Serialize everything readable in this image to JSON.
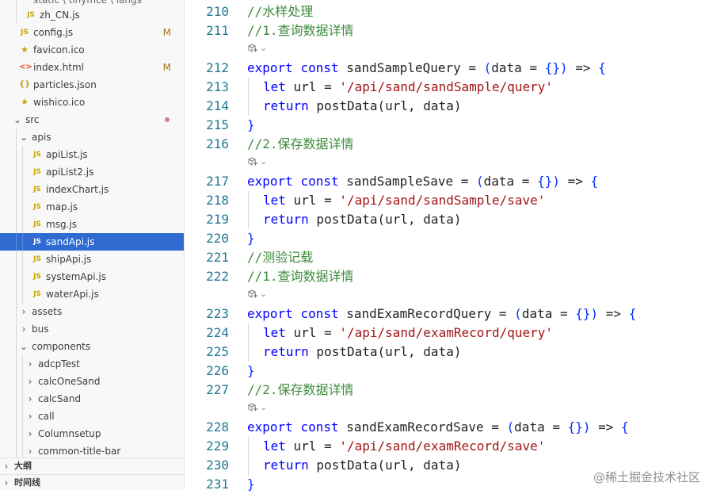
{
  "explorer": {
    "top_partial": "static \\ tinymce \\ langs",
    "items": [
      {
        "name": "zh_CN.js",
        "icon": "js"
      },
      {
        "name": "config.js",
        "icon": "js",
        "badge": "M"
      },
      {
        "name": "favicon.ico",
        "icon": "star"
      },
      {
        "name": "index.html",
        "icon": "html",
        "badge": "M"
      },
      {
        "name": "particles.json",
        "icon": "json"
      },
      {
        "name": "wishico.ico",
        "icon": "star"
      },
      {
        "name": "src",
        "icon": "folder-open"
      },
      {
        "name": "apis",
        "icon": "folder-open"
      },
      {
        "name": "apiList.js",
        "icon": "js"
      },
      {
        "name": "apiList2.js",
        "icon": "js"
      },
      {
        "name": "indexChart.js",
        "icon": "js"
      },
      {
        "name": "map.js",
        "icon": "js"
      },
      {
        "name": "msg.js",
        "icon": "js"
      },
      {
        "name": "sandApi.js",
        "icon": "js",
        "selected": true
      },
      {
        "name": "shipApi.js",
        "icon": "js"
      },
      {
        "name": "systemApi.js",
        "icon": "js"
      },
      {
        "name": "waterApi.js",
        "icon": "js"
      },
      {
        "name": "assets",
        "icon": "folder"
      },
      {
        "name": "bus",
        "icon": "folder"
      },
      {
        "name": "components",
        "icon": "folder-open"
      },
      {
        "name": "adcpTest",
        "icon": "folder"
      },
      {
        "name": "calcOneSand",
        "icon": "folder"
      },
      {
        "name": "calcSand",
        "icon": "folder"
      },
      {
        "name": "call",
        "icon": "folder"
      },
      {
        "name": "Columnsetup",
        "icon": "folder"
      },
      {
        "name": "common-title-bar",
        "icon": "folder"
      }
    ],
    "js_icon_text": "JS",
    "html_icon_text": "<>",
    "json_icon_text": "{}",
    "star_icon_text": "★",
    "badge_text": "M",
    "panels": [
      {
        "label": "大纲"
      },
      {
        "label": "时间线"
      }
    ],
    "colors": {
      "selected_bg": "#2f6bd1",
      "modified": "#a8741a",
      "js": "#c9a400"
    }
  },
  "editor": {
    "lines": [
      {
        "n": "210",
        "parts": [
          [
            "cmt",
            "//水样处理"
          ]
        ]
      },
      {
        "n": "211",
        "parts": [
          [
            "cmt",
            "//1.查询数据详情"
          ]
        ],
        "lens": true
      },
      {
        "n": "212",
        "parts": [
          [
            "kw",
            "export"
          ],
          [
            "punc",
            " "
          ],
          [
            "kw",
            "const"
          ],
          [
            "punc",
            " sandSampleQuery = "
          ],
          [
            "brace",
            "("
          ],
          [
            "punc",
            "data = "
          ],
          [
            "brace",
            "{}"
          ],
          [
            "brace",
            ")"
          ],
          [
            "punc",
            " => "
          ],
          [
            "brace",
            "{"
          ]
        ]
      },
      {
        "n": "213",
        "indent": true,
        "parts": [
          [
            "kw",
            "let"
          ],
          [
            "punc",
            " url = "
          ],
          [
            "str",
            "'/api/sand/sandSample/query'"
          ]
        ]
      },
      {
        "n": "214",
        "indent": true,
        "parts": [
          [
            "kw",
            "return"
          ],
          [
            "punc",
            " postData(url, data)"
          ]
        ]
      },
      {
        "n": "215",
        "parts": [
          [
            "brace",
            "}"
          ]
        ]
      },
      {
        "n": "216",
        "parts": [
          [
            "cmt",
            "//2.保存数据详情"
          ]
        ],
        "lens": true
      },
      {
        "n": "217",
        "parts": [
          [
            "kw",
            "export"
          ],
          [
            "punc",
            " "
          ],
          [
            "kw",
            "const"
          ],
          [
            "punc",
            " sandSampleSave = "
          ],
          [
            "brace",
            "("
          ],
          [
            "punc",
            "data = "
          ],
          [
            "brace",
            "{}"
          ],
          [
            "brace",
            ")"
          ],
          [
            "punc",
            " => "
          ],
          [
            "brace",
            "{"
          ]
        ]
      },
      {
        "n": "218",
        "indent": true,
        "parts": [
          [
            "kw",
            "let"
          ],
          [
            "punc",
            " url = "
          ],
          [
            "str",
            "'/api/sand/sandSample/save'"
          ]
        ]
      },
      {
        "n": "219",
        "indent": true,
        "parts": [
          [
            "kw",
            "return"
          ],
          [
            "punc",
            " postData(url, data)"
          ]
        ]
      },
      {
        "n": "220",
        "parts": [
          [
            "brace",
            "}"
          ]
        ]
      },
      {
        "n": "221",
        "parts": [
          [
            "cmt",
            "//测验记载"
          ]
        ]
      },
      {
        "n": "222",
        "parts": [
          [
            "cmt",
            "//1.查询数据详情"
          ]
        ],
        "lens": true
      },
      {
        "n": "223",
        "parts": [
          [
            "kw",
            "export"
          ],
          [
            "punc",
            " "
          ],
          [
            "kw",
            "const"
          ],
          [
            "punc",
            " sandExamRecordQuery = "
          ],
          [
            "brace",
            "("
          ],
          [
            "punc",
            "data = "
          ],
          [
            "brace",
            "{}"
          ],
          [
            "brace",
            ")"
          ],
          [
            "punc",
            " => "
          ],
          [
            "brace",
            "{"
          ]
        ]
      },
      {
        "n": "224",
        "indent": true,
        "parts": [
          [
            "kw",
            "let"
          ],
          [
            "punc",
            " url = "
          ],
          [
            "str",
            "'/api/sand/examRecord/query'"
          ]
        ]
      },
      {
        "n": "225",
        "indent": true,
        "parts": [
          [
            "kw",
            "return"
          ],
          [
            "punc",
            " postData(url, data)"
          ]
        ]
      },
      {
        "n": "226",
        "parts": [
          [
            "brace",
            "}"
          ]
        ]
      },
      {
        "n": "227",
        "parts": [
          [
            "cmt",
            "//2.保存数据详情"
          ]
        ],
        "lens": true
      },
      {
        "n": "228",
        "parts": [
          [
            "kw",
            "export"
          ],
          [
            "punc",
            " "
          ],
          [
            "kw",
            "const"
          ],
          [
            "punc",
            " sandExamRecordSave = "
          ],
          [
            "brace",
            "("
          ],
          [
            "punc",
            "data = "
          ],
          [
            "brace",
            "{}"
          ],
          [
            "brace",
            ")"
          ],
          [
            "punc",
            " => "
          ],
          [
            "brace",
            "{"
          ]
        ]
      },
      {
        "n": "229",
        "indent": true,
        "parts": [
          [
            "kw",
            "let"
          ],
          [
            "punc",
            " url = "
          ],
          [
            "str",
            "'/api/sand/examRecord/save'"
          ]
        ]
      },
      {
        "n": "230",
        "indent": true,
        "parts": [
          [
            "kw",
            "return"
          ],
          [
            "punc",
            " postData(url, data)"
          ]
        ]
      },
      {
        "n": "231",
        "parts": [
          [
            "brace",
            "}"
          ]
        ]
      }
    ],
    "colors": {
      "comment": "#3d8b3d",
      "keyword": "#0000ff",
      "string": "#a31515",
      "line_number": "#237893"
    }
  },
  "watermark": "@稀土掘金技术社区"
}
